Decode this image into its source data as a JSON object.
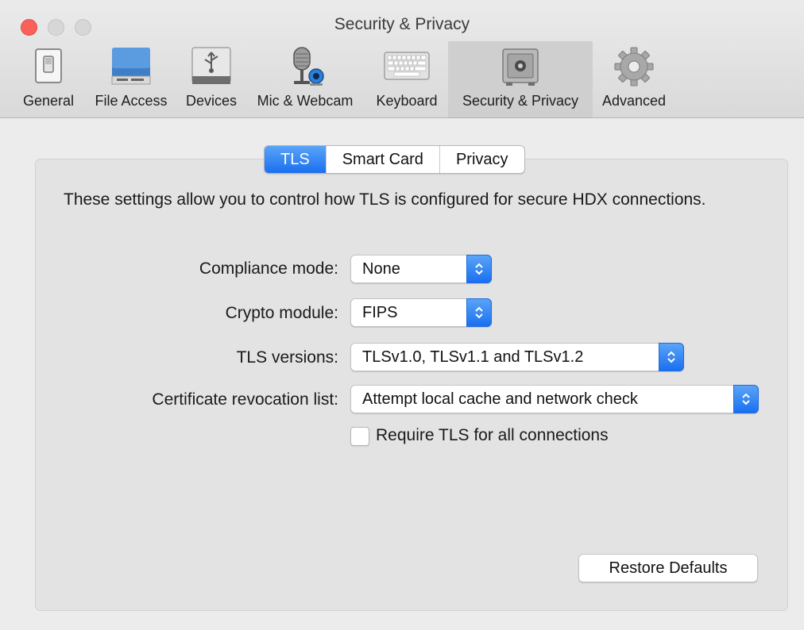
{
  "window": {
    "title": "Security & Privacy"
  },
  "toolbar": {
    "items": [
      {
        "label": "General",
        "icon": "general-switch-icon",
        "selected": false
      },
      {
        "label": "File Access",
        "icon": "hard-drive-icon",
        "selected": false
      },
      {
        "label": "Devices",
        "icon": "usb-drive-icon",
        "selected": false
      },
      {
        "label": "Mic & Webcam",
        "icon": "microphone-webcam-icon",
        "selected": false
      },
      {
        "label": "Keyboard",
        "icon": "keyboard-icon",
        "selected": false
      },
      {
        "label": "Security & Privacy",
        "icon": "safe-icon",
        "selected": true
      },
      {
        "label": "Advanced",
        "icon": "gear-icon",
        "selected": false
      }
    ]
  },
  "tabs": [
    {
      "label": "TLS",
      "active": true
    },
    {
      "label": "Smart Card",
      "active": false
    },
    {
      "label": "Privacy",
      "active": false
    }
  ],
  "tls": {
    "description": "These settings allow you to control how TLS is configured for secure HDX connections.",
    "compliance_label": "Compliance mode:",
    "compliance_value": "None",
    "crypto_label": "Crypto module:",
    "crypto_value": "FIPS",
    "versions_label": "TLS versions:",
    "versions_value": "TLSv1.0, TLSv1.1 and TLSv1.2",
    "crl_label": "Certificate revocation list:",
    "crl_value": "Attempt local cache and network check",
    "require_tls_label": "Require TLS for all connections",
    "require_tls_checked": false,
    "restore_label": "Restore Defaults"
  },
  "colors": {
    "accent": "#1a6ff0",
    "close_button": "#fc605b"
  }
}
